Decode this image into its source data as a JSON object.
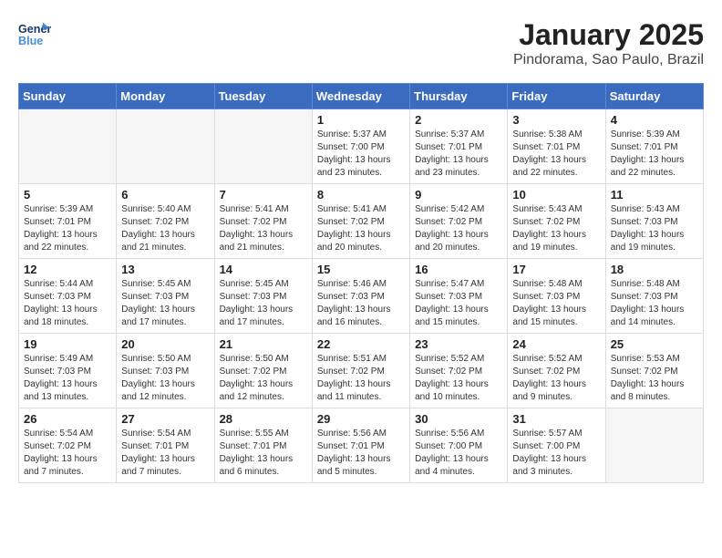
{
  "logo": {
    "line1": "General",
    "line2": "Blue"
  },
  "title": "January 2025",
  "subtitle": "Pindorama, Sao Paulo, Brazil",
  "days_of_week": [
    "Sunday",
    "Monday",
    "Tuesday",
    "Wednesday",
    "Thursday",
    "Friday",
    "Saturday"
  ],
  "weeks": [
    [
      {
        "day": "",
        "info": ""
      },
      {
        "day": "",
        "info": ""
      },
      {
        "day": "",
        "info": ""
      },
      {
        "day": "1",
        "info": "Sunrise: 5:37 AM\nSunset: 7:00 PM\nDaylight: 13 hours and 23 minutes."
      },
      {
        "day": "2",
        "info": "Sunrise: 5:37 AM\nSunset: 7:01 PM\nDaylight: 13 hours and 23 minutes."
      },
      {
        "day": "3",
        "info": "Sunrise: 5:38 AM\nSunset: 7:01 PM\nDaylight: 13 hours and 22 minutes."
      },
      {
        "day": "4",
        "info": "Sunrise: 5:39 AM\nSunset: 7:01 PM\nDaylight: 13 hours and 22 minutes."
      }
    ],
    [
      {
        "day": "5",
        "info": "Sunrise: 5:39 AM\nSunset: 7:01 PM\nDaylight: 13 hours and 22 minutes."
      },
      {
        "day": "6",
        "info": "Sunrise: 5:40 AM\nSunset: 7:02 PM\nDaylight: 13 hours and 21 minutes."
      },
      {
        "day": "7",
        "info": "Sunrise: 5:41 AM\nSunset: 7:02 PM\nDaylight: 13 hours and 21 minutes."
      },
      {
        "day": "8",
        "info": "Sunrise: 5:41 AM\nSunset: 7:02 PM\nDaylight: 13 hours and 20 minutes."
      },
      {
        "day": "9",
        "info": "Sunrise: 5:42 AM\nSunset: 7:02 PM\nDaylight: 13 hours and 20 minutes."
      },
      {
        "day": "10",
        "info": "Sunrise: 5:43 AM\nSunset: 7:02 PM\nDaylight: 13 hours and 19 minutes."
      },
      {
        "day": "11",
        "info": "Sunrise: 5:43 AM\nSunset: 7:03 PM\nDaylight: 13 hours and 19 minutes."
      }
    ],
    [
      {
        "day": "12",
        "info": "Sunrise: 5:44 AM\nSunset: 7:03 PM\nDaylight: 13 hours and 18 minutes."
      },
      {
        "day": "13",
        "info": "Sunrise: 5:45 AM\nSunset: 7:03 PM\nDaylight: 13 hours and 17 minutes."
      },
      {
        "day": "14",
        "info": "Sunrise: 5:45 AM\nSunset: 7:03 PM\nDaylight: 13 hours and 17 minutes."
      },
      {
        "day": "15",
        "info": "Sunrise: 5:46 AM\nSunset: 7:03 PM\nDaylight: 13 hours and 16 minutes."
      },
      {
        "day": "16",
        "info": "Sunrise: 5:47 AM\nSunset: 7:03 PM\nDaylight: 13 hours and 15 minutes."
      },
      {
        "day": "17",
        "info": "Sunrise: 5:48 AM\nSunset: 7:03 PM\nDaylight: 13 hours and 15 minutes."
      },
      {
        "day": "18",
        "info": "Sunrise: 5:48 AM\nSunset: 7:03 PM\nDaylight: 13 hours and 14 minutes."
      }
    ],
    [
      {
        "day": "19",
        "info": "Sunrise: 5:49 AM\nSunset: 7:03 PM\nDaylight: 13 hours and 13 minutes."
      },
      {
        "day": "20",
        "info": "Sunrise: 5:50 AM\nSunset: 7:03 PM\nDaylight: 13 hours and 12 minutes."
      },
      {
        "day": "21",
        "info": "Sunrise: 5:50 AM\nSunset: 7:02 PM\nDaylight: 13 hours and 12 minutes."
      },
      {
        "day": "22",
        "info": "Sunrise: 5:51 AM\nSunset: 7:02 PM\nDaylight: 13 hours and 11 minutes."
      },
      {
        "day": "23",
        "info": "Sunrise: 5:52 AM\nSunset: 7:02 PM\nDaylight: 13 hours and 10 minutes."
      },
      {
        "day": "24",
        "info": "Sunrise: 5:52 AM\nSunset: 7:02 PM\nDaylight: 13 hours and 9 minutes."
      },
      {
        "day": "25",
        "info": "Sunrise: 5:53 AM\nSunset: 7:02 PM\nDaylight: 13 hours and 8 minutes."
      }
    ],
    [
      {
        "day": "26",
        "info": "Sunrise: 5:54 AM\nSunset: 7:02 PM\nDaylight: 13 hours and 7 minutes."
      },
      {
        "day": "27",
        "info": "Sunrise: 5:54 AM\nSunset: 7:01 PM\nDaylight: 13 hours and 7 minutes."
      },
      {
        "day": "28",
        "info": "Sunrise: 5:55 AM\nSunset: 7:01 PM\nDaylight: 13 hours and 6 minutes."
      },
      {
        "day": "29",
        "info": "Sunrise: 5:56 AM\nSunset: 7:01 PM\nDaylight: 13 hours and 5 minutes."
      },
      {
        "day": "30",
        "info": "Sunrise: 5:56 AM\nSunset: 7:00 PM\nDaylight: 13 hours and 4 minutes."
      },
      {
        "day": "31",
        "info": "Sunrise: 5:57 AM\nSunset: 7:00 PM\nDaylight: 13 hours and 3 minutes."
      },
      {
        "day": "",
        "info": ""
      }
    ]
  ]
}
